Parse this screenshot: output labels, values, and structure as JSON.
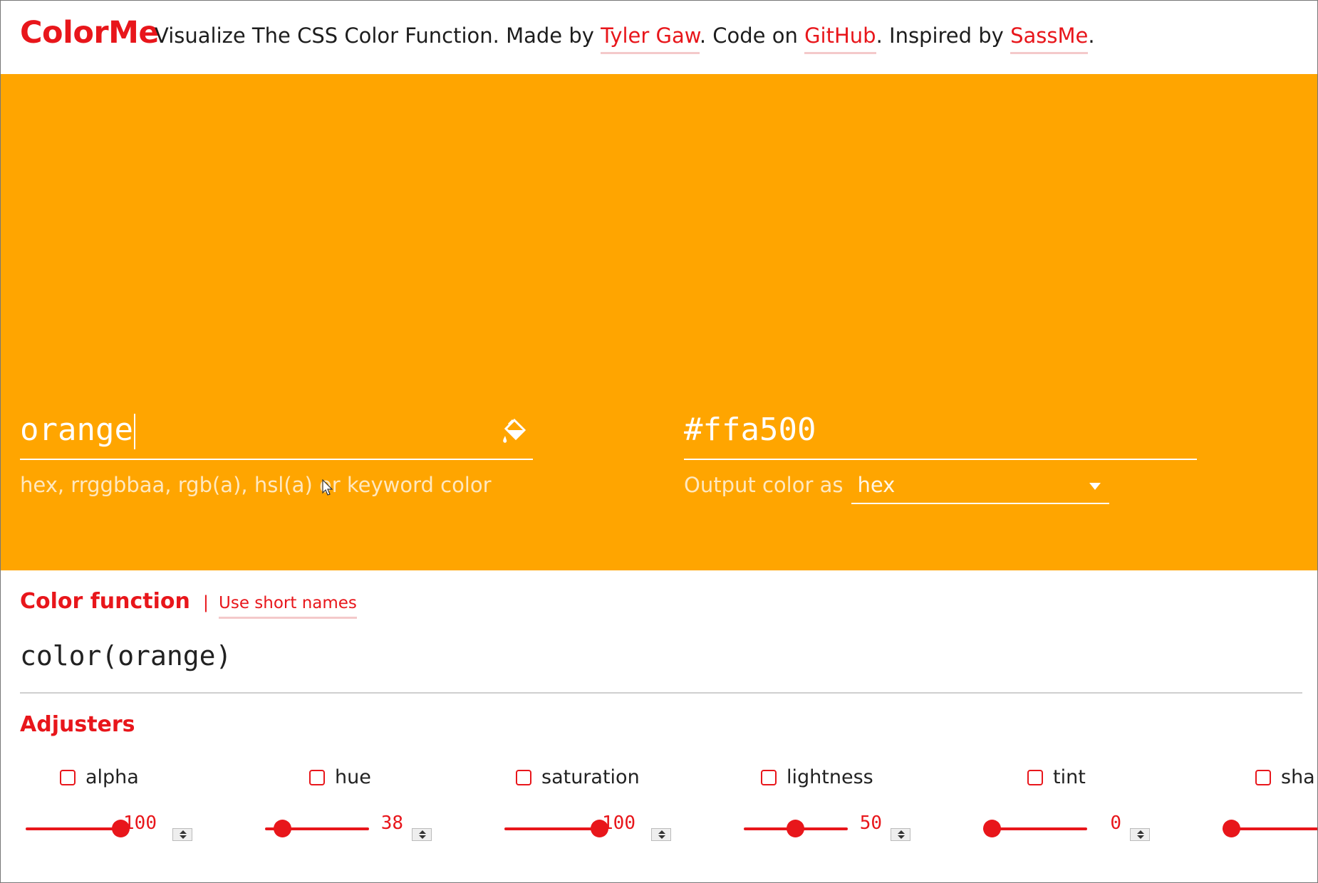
{
  "header": {
    "brand": "ColorMe",
    "tagline_prefix": "Visualize The CSS Color Function. Made by ",
    "author_link": "Tyler Gaw",
    "code_text": ". Code on ",
    "github_link": "GitHub",
    "inspired_text": ". Inspired by ",
    "sassme_link": "SassMe",
    "end_text": "."
  },
  "panel": {
    "background_color": "#ffa500",
    "input_value": "orange",
    "input_hint": "hex, rrggbbaa, rgb(a), hsl(a) or keyword color",
    "output_value": "#ffa500",
    "output_label": "Output color as",
    "output_format": "hex"
  },
  "function": {
    "title": "Color function",
    "separator": "|",
    "short_names_link": "Use short names",
    "output": "color(orange)"
  },
  "adjusters": {
    "title": "Adjusters",
    "items": [
      {
        "label": "alpha",
        "value": "100",
        "fraction": 1.0
      },
      {
        "label": "hue",
        "value": "38",
        "fraction": 0.1
      },
      {
        "label": "saturation",
        "value": "100",
        "fraction": 1.0
      },
      {
        "label": "lightness",
        "value": "50",
        "fraction": 0.5
      },
      {
        "label": "tint",
        "value": "0",
        "fraction": 0.0
      },
      {
        "label": "sha",
        "value": "",
        "fraction": 0.0
      }
    ]
  },
  "colors": {
    "accent": "#e8161b",
    "panel": "#ffa500"
  }
}
